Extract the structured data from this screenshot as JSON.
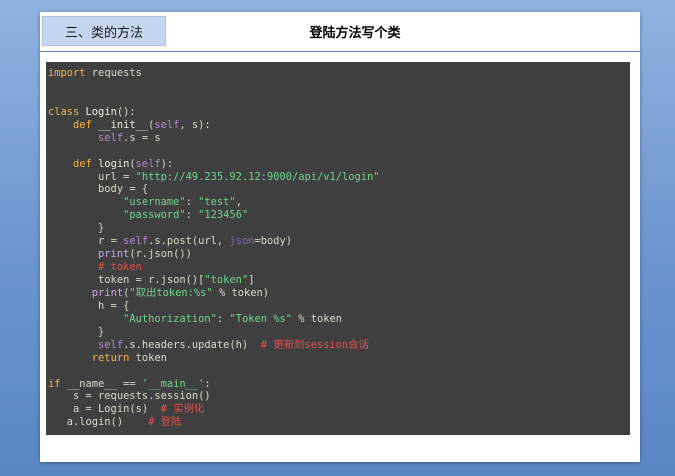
{
  "section_tab": "三、类的方法",
  "slide_title": "登陆方法写个类",
  "code_lines": [
    [
      {
        "t": "import",
        "c": "kw"
      },
      {
        "t": " requests",
        "c": "txt"
      }
    ],
    [],
    [],
    [
      {
        "t": "class ",
        "c": "kw"
      },
      {
        "t": "Login",
        "c": "fn"
      },
      {
        "t": "():",
        "c": "txt"
      }
    ],
    [
      {
        "t": "    ",
        "c": "txt"
      },
      {
        "t": "def ",
        "c": "kw"
      },
      {
        "t": "__init__",
        "c": "fn"
      },
      {
        "t": "(",
        "c": "txt"
      },
      {
        "t": "self",
        "c": "slf"
      },
      {
        "t": ", s):",
        "c": "txt"
      }
    ],
    [
      {
        "t": "        ",
        "c": "txt"
      },
      {
        "t": "self",
        "c": "slf"
      },
      {
        "t": ".s = s",
        "c": "txt"
      }
    ],
    [],
    [
      {
        "t": "    ",
        "c": "txt"
      },
      {
        "t": "def ",
        "c": "kw"
      },
      {
        "t": "login",
        "c": "fn"
      },
      {
        "t": "(",
        "c": "txt"
      },
      {
        "t": "self",
        "c": "slf"
      },
      {
        "t": "):",
        "c": "txt"
      }
    ],
    [
      {
        "t": "        url = ",
        "c": "txt"
      },
      {
        "t": "\"http://49.235.92.12:9000/api/v1/login\"",
        "c": "str"
      }
    ],
    [
      {
        "t": "        body = {",
        "c": "txt"
      }
    ],
    [
      {
        "t": "            ",
        "c": "txt"
      },
      {
        "t": "\"username\"",
        "c": "str"
      },
      {
        "t": ": ",
        "c": "txt"
      },
      {
        "t": "\"test\"",
        "c": "str"
      },
      {
        "t": ",",
        "c": "txt"
      }
    ],
    [
      {
        "t": "            ",
        "c": "txt"
      },
      {
        "t": "\"password\"",
        "c": "str"
      },
      {
        "t": ": ",
        "c": "txt"
      },
      {
        "t": "\"123456\"",
        "c": "str"
      }
    ],
    [
      {
        "t": "        }",
        "c": "txt"
      }
    ],
    [
      {
        "t": "        r = ",
        "c": "txt"
      },
      {
        "t": "self",
        "c": "slf"
      },
      {
        "t": ".s.post(url, ",
        "c": "txt"
      },
      {
        "t": "json",
        "c": "dim"
      },
      {
        "t": "=body)",
        "c": "txt"
      }
    ],
    [
      {
        "t": "        ",
        "c": "txt"
      },
      {
        "t": "print",
        "c": "bi"
      },
      {
        "t": "(r.json())",
        "c": "txt"
      }
    ],
    [
      {
        "t": "        ",
        "c": "txt"
      },
      {
        "t": "# token",
        "c": "cmt"
      }
    ],
    [
      {
        "t": "        token = r.json()[",
        "c": "txt"
      },
      {
        "t": "\"token\"",
        "c": "str"
      },
      {
        "t": "]",
        "c": "txt"
      }
    ],
    [
      {
        "t": "       ",
        "c": "txt"
      },
      {
        "t": "print",
        "c": "bi"
      },
      {
        "t": "(",
        "c": "txt"
      },
      {
        "t": "\"取出token:%s\"",
        "c": "str"
      },
      {
        "t": " % token)",
        "c": "txt"
      }
    ],
    [
      {
        "t": "        h = {",
        "c": "txt"
      }
    ],
    [
      {
        "t": "            ",
        "c": "txt"
      },
      {
        "t": "\"Authorization\"",
        "c": "str"
      },
      {
        "t": ": ",
        "c": "txt"
      },
      {
        "t": "\"Token %s\"",
        "c": "str"
      },
      {
        "t": " % token",
        "c": "txt"
      }
    ],
    [
      {
        "t": "        }",
        "c": "txt"
      }
    ],
    [
      {
        "t": "        ",
        "c": "txt"
      },
      {
        "t": "self",
        "c": "slf"
      },
      {
        "t": ".s.headers.update(h)  ",
        "c": "txt"
      },
      {
        "t": "# 更新到session会话",
        "c": "cmt"
      }
    ],
    [
      {
        "t": "       ",
        "c": "txt"
      },
      {
        "t": "return",
        "c": "kw"
      },
      {
        "t": " token",
        "c": "txt"
      }
    ],
    [],
    [
      {
        "t": "if",
        "c": "kw"
      },
      {
        "t": " __name__ == ",
        "c": "txt"
      },
      {
        "t": "'__main__'",
        "c": "str"
      },
      {
        "t": ":",
        "c": "txt"
      }
    ],
    [
      {
        "t": "    s = requests.session()",
        "c": "txt"
      }
    ],
    [
      {
        "t": "    a = Login(s)  ",
        "c": "txt"
      },
      {
        "t": "# 实例化",
        "c": "cmt"
      }
    ],
    [
      {
        "t": "   a.login()    ",
        "c": "txt"
      },
      {
        "t": "# 登陆",
        "c": "cmt"
      }
    ]
  ]
}
